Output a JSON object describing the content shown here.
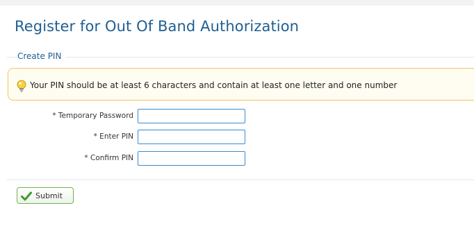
{
  "page": {
    "title": "Register for Out Of Band Authorization"
  },
  "section": {
    "legend": "Create PIN"
  },
  "hint": {
    "text": "Your PIN should be at least 6 characters and contain at least one letter and one number",
    "icon": "lightbulb-icon"
  },
  "form": {
    "fields": [
      {
        "label": "* Temporary Password",
        "value": "",
        "placeholder": ""
      },
      {
        "label": "* Enter PIN",
        "value": "",
        "placeholder": ""
      },
      {
        "label": "* Confirm PIN",
        "value": "",
        "placeholder": ""
      }
    ]
  },
  "actions": {
    "submit_label": "Submit",
    "submit_icon": "checkmark-icon"
  },
  "colors": {
    "title": "#1f5f93",
    "hint_border": "#f5c45a",
    "hint_bg": "#fffdf2",
    "input_border": "#3a8bd0",
    "submit_border": "#6db64f",
    "check_green": "#3d9b2f"
  }
}
